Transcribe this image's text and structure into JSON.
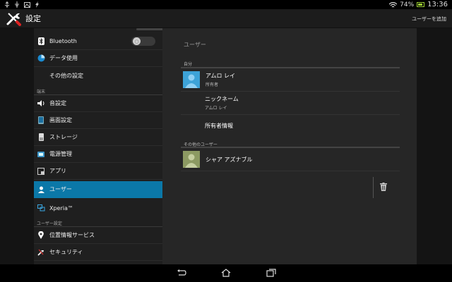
{
  "status": {
    "battery": "74%",
    "time": "13:36"
  },
  "app": {
    "title": "設定",
    "action_add_user": "ユーザーを追加"
  },
  "colors": {
    "accent": "#0b78a8",
    "right_bg": "#262626",
    "left_bg": "#1f1f1f"
  },
  "sidebar": {
    "items": [
      {
        "label": "Bluetooth",
        "icon": "bluetooth-icon"
      },
      {
        "label": "データ使用",
        "icon": "data-usage-icon"
      },
      {
        "label": "その他の設定",
        "icon": ""
      },
      {
        "label": "音設定",
        "icon": "sound-icon"
      },
      {
        "label": "画面設定",
        "icon": "display-icon"
      },
      {
        "label": "ストレージ",
        "icon": "storage-icon"
      },
      {
        "label": "電源管理",
        "icon": "battery-icon"
      },
      {
        "label": "アプリ",
        "icon": "apps-icon"
      },
      {
        "label": "ユーザー",
        "icon": "user-icon"
      },
      {
        "label": "Xperia™",
        "icon": "xperia-icon"
      },
      {
        "label": "位置情報サービス",
        "icon": "location-icon"
      },
      {
        "label": "セキュリティ",
        "icon": "security-icon"
      }
    ],
    "section_device": "端末",
    "section_user_settings": "ユーザー設定",
    "selected": "ユーザー"
  },
  "main": {
    "title": "ユーザー",
    "section_self": "自分",
    "self_user": {
      "name": "アムロ レイ",
      "role": "所有者"
    },
    "nickname": {
      "label": "ニックネーム",
      "value": "アムロ レイ"
    },
    "owner_info": "所有者情報",
    "section_other": "その他のユーザー",
    "other_user": {
      "name": "シャア アズナブル"
    }
  }
}
